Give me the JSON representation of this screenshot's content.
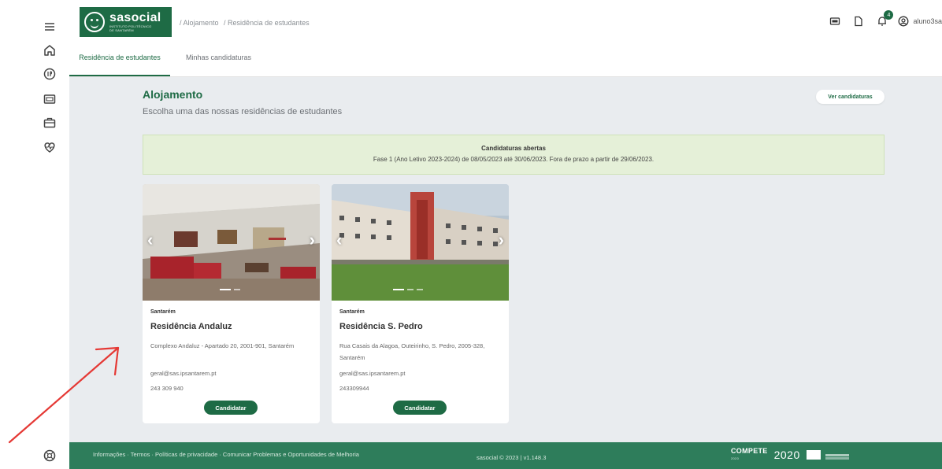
{
  "header": {
    "brand": "sasocial",
    "brand_sub_1": "INSTITUTO POLITÉCNICO",
    "brand_sub_2": "DE SANTARÉM",
    "breadcrumb": [
      "/ Alojamento",
      "/ Residência de estudantes"
    ],
    "notifications_count": "4",
    "username": "aluno3sa"
  },
  "tabs": [
    {
      "label": "Residência de estudantes",
      "active": true
    },
    {
      "label": "Minhas candidaturas",
      "active": false
    }
  ],
  "main": {
    "title": "Alojamento",
    "subtitle": "Escolha uma das nossas residências de estudantes",
    "view_button": "Ver candidaturas"
  },
  "notice": {
    "title": "Candidaturas abertas",
    "body": "Fase 1 (Ano Letivo 2023-2024) de 08/05/2023 até 30/06/2023. Fora de prazo a partir de 29/06/2023."
  },
  "residences": [
    {
      "city": "Santarém",
      "name": "Residência Andaluz",
      "address": "Complexo Andaluz - Apartado 20, 2001-901, Santarém",
      "email": "geral@sas.ipsantarem.pt",
      "phone": "243 309 940",
      "button": "Candidatar"
    },
    {
      "city": "Santarém",
      "name": "Residência S. Pedro",
      "address": "Rua Casais da Alagoa, Outeirinho, S. Pedro, 2005-328, Santarém",
      "email": "geral@sas.ipsantarem.pt",
      "phone": "243309944",
      "button": "Candidatar"
    }
  ],
  "footer": {
    "links": "Informações · Termos · Políticas de privacidade · Comunicar Problemas e Oportunidades de Melhoria",
    "version": "sasocial © 2023 | v1.148.3",
    "compete": "COMPETE",
    "compete_year": "2020",
    "portugal2020": "2020"
  },
  "colors": {
    "brand_green": "#1e6b45",
    "footer_green": "#2e7d5b",
    "notice_bg": "#e5f0d8",
    "annotation_red": "#e53935"
  },
  "icons": {
    "rail": [
      "menu-icon",
      "home-icon",
      "food-icon",
      "wallet-icon",
      "briefcase-icon",
      "health-icon",
      "support-icon"
    ],
    "header": [
      "card-icon",
      "document-icon",
      "bell-icon",
      "user-icon"
    ]
  }
}
